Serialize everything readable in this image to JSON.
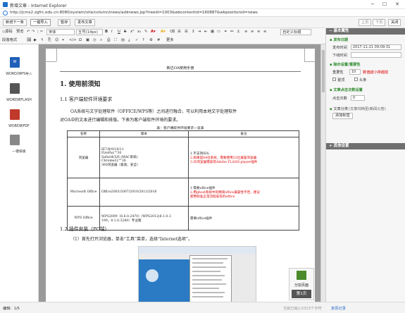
{
  "window": {
    "title": "新增文章 - Internet Explorer",
    "url": "http://jcms2.zgfrc.edu.cn:8080/system/site/column/news/addnews.jsp?treeid=1003&wbcontentid=160887&wbpositionid=news"
  },
  "toolbar": {
    "new_next": "新增下一条",
    "import_one": "一键导入",
    "save": "暂存",
    "publish": "发布文章",
    "prev": "上页",
    "next": "下页",
    "close": "关闭"
  },
  "editor": {
    "source": "源码",
    "preview": "预览",
    "font": "宋体",
    "size": "五号(14px)",
    "style": "自定义标题",
    "more": "更多",
    "format": "段落格式"
  },
  "left_tools": [
    {
      "label": "WORD/WPS导入"
    },
    {
      "label": "WORD转FLASH"
    },
    {
      "label": "WORD转PDF"
    },
    {
      "label": "一键排版"
    }
  ],
  "doc": {
    "header": "新达OA使用手册",
    "h1": "1. 使用前须知",
    "h2a": "1.1  客户端软件环境要求",
    "para1": "OA系统与文字处理软件（OFFICE/WPS等）之间进行融合，可以利用本地文字处理软件",
    "para2": "对OA中的文本进行编辑和排版。下表为客户端软件环境的要求。",
    "tcaption": "表：客户端软件环境要求一览表",
    "th": [
      "名称",
      "版本",
      "备注"
    ],
    "rows": [
      {
        "name": "浏览器",
        "ver": [
          "IE7/8/9/10/11",
          "FirePox™30",
          "Safari4/5/6 (MAC系统)",
          "Chrome32™26",
          "360浏览器（极速，安全）"
        ],
        "note_black": "1.不支持IE6;",
        "note_red": [
          "2.如果是64位系统，需要使用32位兼容浏览器",
          "3.IE浏览器需安装Adobe FLASH player插件"
        ]
      },
      {
        "name": "Microsoft Office",
        "ver": [
          "Office2003/2007/2010/2013/2016"
        ],
        "note_black": "1.需要office插件",
        "note_red": [
          "2.用ghost系统中的精简office兼容性不佳，建议",
          "使用标准正常流程安装的office"
        ]
      },
      {
        "name": "WPS Office",
        "ver": [
          "WPS2009（6.6.0.2470）/WPS2012(8.1.0.3",
          "199，8.1.0.3280）专业版"
        ],
        "note_black": "需要office插件",
        "note_red": []
      }
    ],
    "h2b": "1.2  插件安装（PC端）",
    "step1": "（1）首先打开浏览器，单击“工具”菜单，选择“Internet选项”。"
  },
  "right": {
    "header": "基本属性",
    "publish_sec": "发布日期",
    "publish_time_label": "发布时间",
    "publish_time": "2017-11-21 09:09:31",
    "offline_label": "下线时间",
    "attach_sec": "除示设置/重要性",
    "importance_label": "重要性",
    "importance_value": "10",
    "importance_note": "数值越小排越前",
    "cb1": "置顶",
    "cb2": "头条",
    "comment_sec": "文章点击次数设置",
    "clicks_label": "点击次数",
    "clicks_value": "0",
    "cat_label": "文章分类",
    "cat_value": "(文章归档至(新闻公告)",
    "add_cat": "添加标签",
    "other": "其他设置"
  },
  "floating": {
    "split": "分割页面",
    "page": "第1页"
  },
  "status": {
    "left": "编辑：1/5",
    "right": "当前已输入5323个字符",
    "right_link": "复原记录"
  }
}
